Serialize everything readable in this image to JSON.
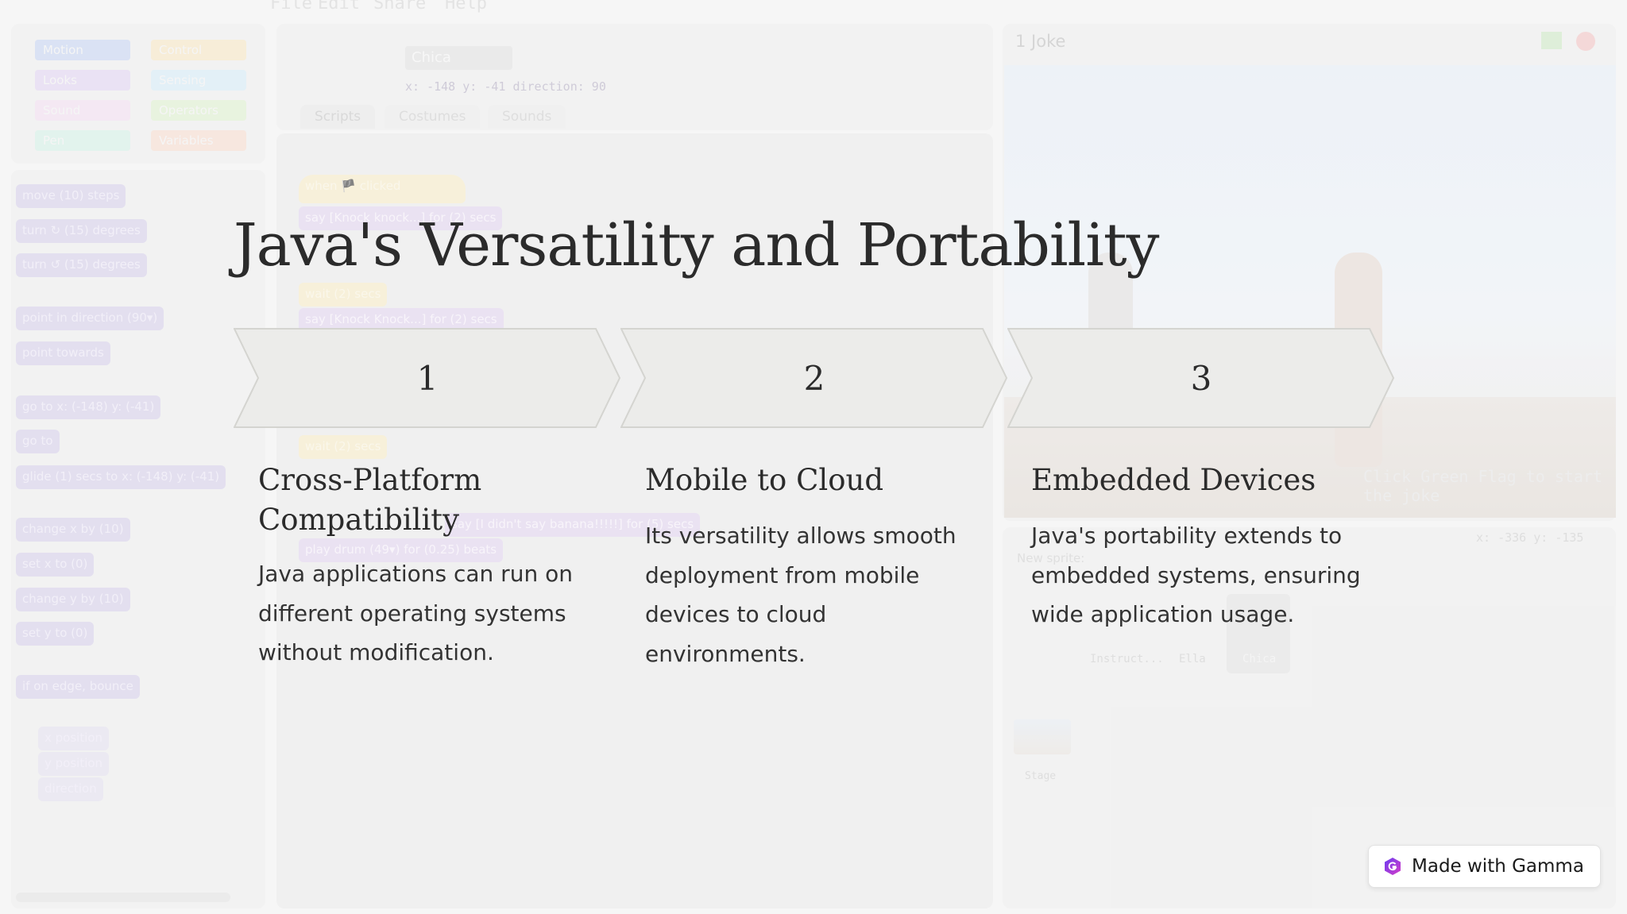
{
  "background": {
    "menu": [
      "File",
      "Edit",
      "Share",
      "Help"
    ],
    "categories": [
      "Motion",
      "Control",
      "Looks",
      "Sensing",
      "Sound",
      "Operators",
      "Pen",
      "Variables"
    ],
    "category_colors": [
      "#c9d6f2",
      "#f6e6c6",
      "#e2d6f2",
      "#d8ecf6",
      "#f1dff0",
      "#dff0d2",
      "#d6f0e6",
      "#f6ddd2"
    ],
    "sprite": {
      "name": "Chica",
      "position": "x: -148  y: -41   direction: 90"
    },
    "tabs": [
      "Scripts",
      "Costumes",
      "Sounds"
    ],
    "palette_blocks": [
      "move (10) steps",
      "turn ↻ (15) degrees",
      "turn ↺ (15) degrees",
      "point in direction (90▾)",
      "point towards",
      "go to x: (-148) y: (-41)",
      "go to",
      "glide (1) secs to x: (-148) y: (-41)",
      "change x by (10)",
      "set x to (0)",
      "change y by (10)",
      "set y to (0)",
      "if on edge, bounce"
    ],
    "reporters": [
      "x position",
      "y position",
      "direction"
    ],
    "script_blocks": [
      "when 🏴 clicked",
      "say [Knock knock...] for (2) secs",
      "wait (2) secs",
      "say [Knock Knock...] for (2) secs",
      "wait (2) secs",
      "say [I didn't say banana!!!!!] for (5) secs",
      "play drum (49▾) for (0.25) beats"
    ],
    "stage_title": "1 Joke",
    "stage_hint": "Click Green Flag to start the joke",
    "stage_coords": "x: -336   y: -135",
    "new_sprite_label": "New sprite:",
    "sprites": [
      "Instruct...",
      "Ella",
      "Chica"
    ],
    "stage_label": "Stage"
  },
  "slide": {
    "title": "Java's Versatility and Portability",
    "steps": [
      {
        "number": "1",
        "heading": "Cross-Platform Compatibility",
        "body": "Java applications can run on different operating systems without modification."
      },
      {
        "number": "2",
        "heading": "Mobile to Cloud",
        "body": "Its versatility allows smooth deployment from mobile devices to cloud environments."
      },
      {
        "number": "3",
        "heading": "Embedded Devices",
        "body": "Java's portability extends to embedded systems, ensuring wide application usage."
      }
    ],
    "chevron_fill": "#ececea",
    "chevron_stroke": "#d4d4d0"
  },
  "badge": {
    "label": "Made with Gamma",
    "icon": "gamma-logo-icon"
  }
}
